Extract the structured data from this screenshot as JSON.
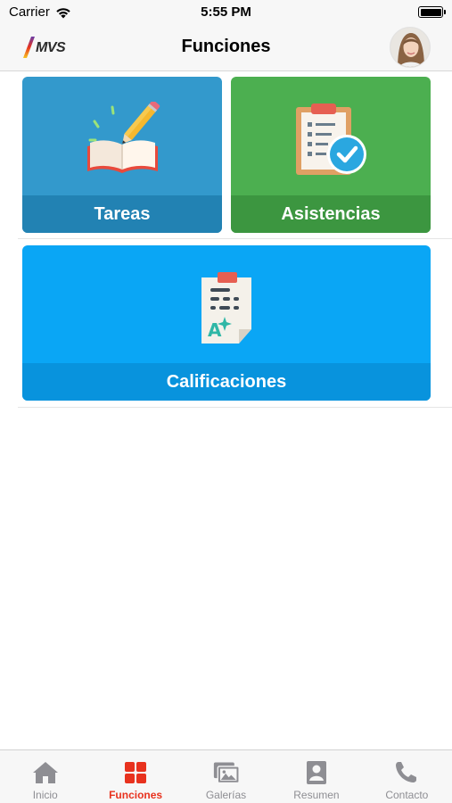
{
  "status_bar": {
    "carrier": "Carrier",
    "time": "5:55 PM"
  },
  "nav": {
    "logo_text": "MVS",
    "title": "Funciones"
  },
  "tiles": [
    {
      "label": "Tareas",
      "icon": "book-pencil-icon"
    },
    {
      "label": "Asistencias",
      "icon": "clipboard-check-icon"
    },
    {
      "label": "Calificaciones",
      "icon": "graded-paper-icon"
    }
  ],
  "tab_bar": {
    "active": "Funciones",
    "items": [
      {
        "label": "Inicio",
        "icon": "home-icon"
      },
      {
        "label": "Funciones",
        "icon": "grid-icon"
      },
      {
        "label": "Galerías",
        "icon": "gallery-icon"
      },
      {
        "label": "Resumen",
        "icon": "profile-card-icon"
      },
      {
        "label": "Contacto",
        "icon": "phone-icon"
      }
    ]
  },
  "colors": {
    "accent_active_tab": "#e8321e",
    "inactive_tab": "#8e8e93",
    "tile_tareas": "#3399cc",
    "tile_asistencias": "#4caf50",
    "tile_calificaciones": "#0aa6f5"
  }
}
